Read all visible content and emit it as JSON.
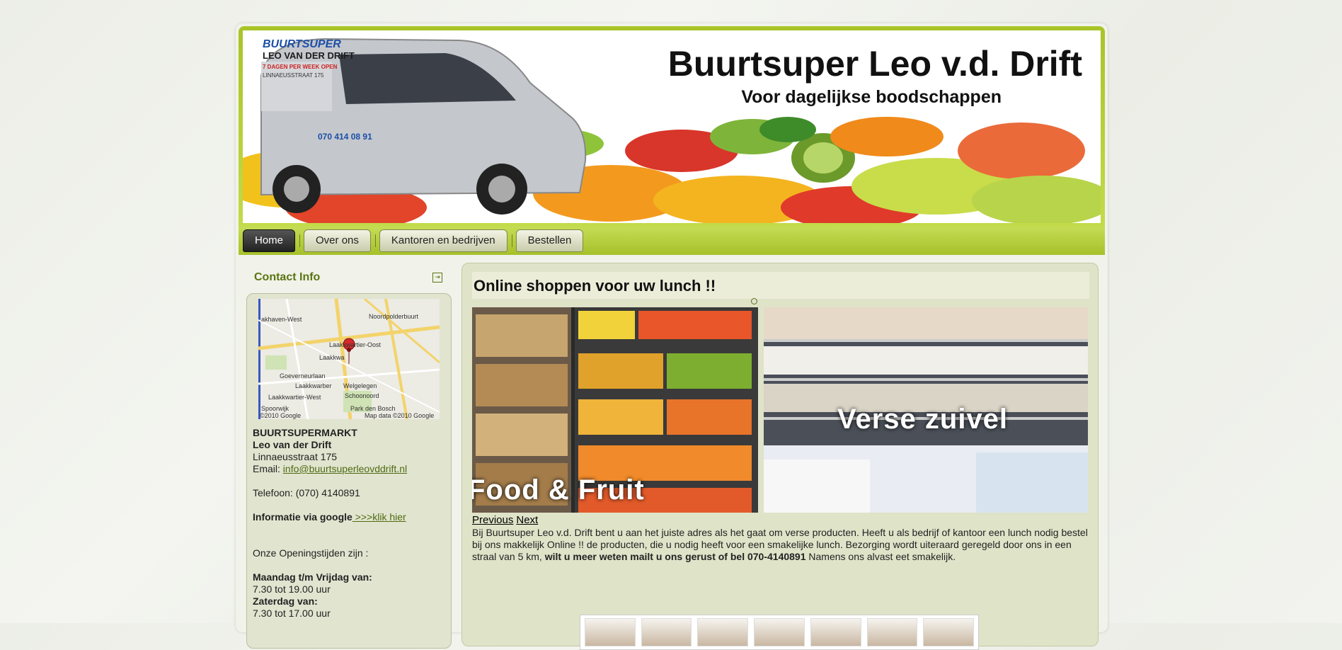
{
  "header": {
    "title": "Buurtsuper Leo v.d. Drift",
    "subtitle": "Voor dagelijkse boodschappen",
    "van_text": [
      "BUURTSUPER",
      "LEO VAN DER DRIFT",
      "7 DAGEN PER WEEK OPEN",
      "LINNAEUSSTRAAT 175",
      "070 414 08 91"
    ]
  },
  "nav": [
    {
      "label": "Home",
      "active": true
    },
    {
      "label": "Over ons",
      "active": false
    },
    {
      "label": "Kantoren en bedrijven",
      "active": false
    },
    {
      "label": "Bestellen",
      "active": false
    }
  ],
  "sidebar": {
    "title": "Contact Info",
    "toggle_icon": "collapse-icon",
    "map": {
      "labels": [
        "akhaven-West",
        "Noordpolderbuurt",
        "Laakkwartier-Oost",
        "Laakkwa",
        "Goeverneurlaan",
        "Laakkwarber",
        "Welgelegen",
        "Laakkwartier-West",
        "Schoonoord",
        "Park den Bosch",
        "Spoorwijk"
      ],
      "copyright": "©2010 Google",
      "data_credit": "Map data ©2010 Google"
    },
    "contact": {
      "company": "BUURTSUPERMARKT",
      "name": "Leo van der Drift",
      "address": "Linnaeusstraat 175",
      "email_label": "Email: ",
      "email": "info@buurtsuperleovddrift.nl",
      "phone": "Telefoon: (070) 4140891",
      "google_info": "Informatie via google",
      "google_link": " >>>klik hier",
      "hours_intro": "Onze Openingstijden zijn :",
      "weekdays_label": "Maandag t/m Vrijdag van:",
      "weekdays_hours": "7.30 tot 19.00 uur",
      "saturday_label": "Zaterdag van:",
      "saturday_hours": "7.30 tot 17.00 uur"
    }
  },
  "main": {
    "title": "Online shoppen voor uw lunch !!",
    "slides": [
      {
        "caption": "Food & Fruit"
      },
      {
        "caption": "Verse zuivel"
      }
    ],
    "controls": {
      "previous": "Previous",
      "next": "Next"
    },
    "text_part1": "Bij Buurtsuper Leo v.d. Drift bent u aan het juiste adres als het gaat om verse producten. Heeft u als bedrijf of kantoor een lunch nodig bestel bij ons makkelijk Online !! de producten, die u nodig heeft voor een smakelijke lunch. Bezorging wordt uiteraard geregeld door ons in een straal van 5 km, ",
    "text_bold": "wilt u meer weten mailt u ons gerust of bel 070-4140891",
    "text_part2": " Namens ons alvast eet smakelijk."
  },
  "colors": {
    "accent": "#a8c427",
    "link": "#4e6b12",
    "content_bg": "#dfe3c8"
  }
}
